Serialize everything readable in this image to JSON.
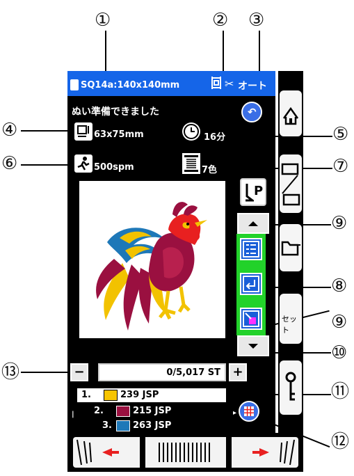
{
  "callouts": {
    "c1": "①",
    "c2": "②",
    "c3": "③",
    "c4": "④",
    "c5": "⑤",
    "c6": "⑥",
    "c7": "⑦",
    "c8": "⑧",
    "c9a": "⑨",
    "c9b": "⑨",
    "c10": "⑩",
    "c11": "⑪",
    "c12": "⑫",
    "c13": "⑬"
  },
  "titlebar": {
    "design_label": "SQ14a:140x140mm",
    "mode_label": "オート"
  },
  "status": {
    "message": "ぬい準備できました"
  },
  "info": {
    "size": "63x75mm",
    "time": "16分",
    "speed": "500spm",
    "colors": "7色"
  },
  "counter": {
    "stitch_label": "0/5,017 ST",
    "minus": "−",
    "plus": "+"
  },
  "thread_list": [
    {
      "index": "1.",
      "code": "239 JSP",
      "color": "#f7c400"
    },
    {
      "index": "2.",
      "code": "215 JSP",
      "color": "#9a1040"
    },
    {
      "index": "3.",
      "code": "263 JSP",
      "color": "#1e78b8"
    }
  ],
  "side_buttons": {
    "set_label": "セット",
    "presser_label": "P"
  },
  "colors": {
    "title_blue": "#1565e8",
    "highlight_green": "#22d22a"
  }
}
